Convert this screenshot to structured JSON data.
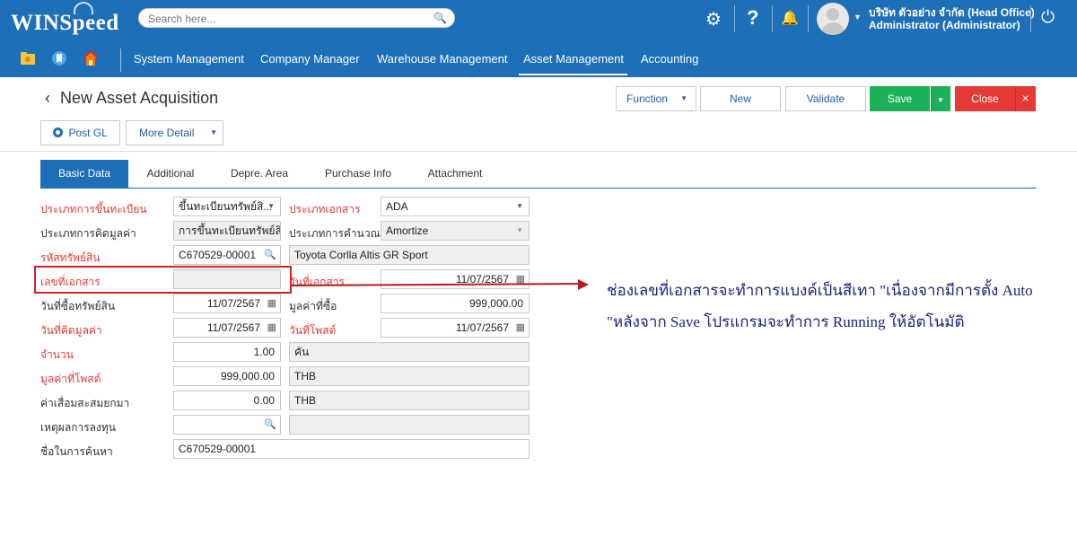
{
  "app": {
    "logo": "WINSpeed",
    "search_placeholder": "Search here...",
    "company": "บริษัท ตัวอย่าง จำกัด (Head Office)",
    "user": "Administrator (Administrator)"
  },
  "icons": {
    "settings": "⚙",
    "help": "?",
    "bell": "🔔",
    "power": "⏻",
    "search": "🔍",
    "calendar": "▦",
    "dropdown": "▼",
    "back": "‹",
    "close": "×"
  },
  "nav": [
    "System Management",
    "Company Manager",
    "Warehouse Management",
    "Asset Management",
    "Accounting"
  ],
  "page": {
    "title": "New Asset Acquisition",
    "buttons": {
      "function": "Function",
      "new": "New",
      "validate": "Validate",
      "save": "Save",
      "close": "Close",
      "post_gl": "Post GL",
      "more_detail": "More Detail"
    }
  },
  "tabs": [
    "Basic Data",
    "Additional",
    "Depre. Area",
    "Purchase Info",
    "Attachment"
  ],
  "form": {
    "reg_type_label": "ประเภทการขึ้นทะเบียน",
    "reg_type_value": "ขึ้นทะเบียนทรัพย์สิ...",
    "doc_type_label": "ประเภทเอกสาร",
    "doc_type_value": "ADA",
    "valuation_type_label": "ประเภทการคิดมูลค่า",
    "valuation_type_value": "การขึ้นทะเบียนทรัพย์สิ",
    "calc_type_label": "ประเภทการคำนวณ",
    "calc_type_value": "Amortize",
    "asset_code_label": "รหัสทรัพย์สิน",
    "asset_code_value": "C670529-00001",
    "asset_name_value": "Toyota Corlla Altis GR Sport",
    "doc_no_label": "เลขที่เอกสาร",
    "doc_no_value": "",
    "doc_date_label": "วันที่เอกสาร",
    "doc_date_value": "11/07/2567",
    "purchase_date_label": "วันที่ซื้อทรัพย์สิน",
    "purchase_date_value": "11/07/2567",
    "purchase_value_label": "มูลค่าที่ซื้อ",
    "purchase_value_value": "999,000.00",
    "valuation_date_label": "วันที่คิดมูลค่า",
    "valuation_date_value": "11/07/2567",
    "post_date_label": "วันที่โพสต์",
    "post_date_value": "11/07/2567",
    "qty_label": "จำนวน",
    "qty_value": "1.00",
    "unit_value": "คัน",
    "post_value_label": "มูลค่าที่โพสต์",
    "post_value_value": "999,000.00",
    "post_value_currency": "THB",
    "accum_depre_label": "ค่าเสื่อมสะสมยกมา",
    "accum_depre_value": "0.00",
    "accum_depre_currency": "THB",
    "invest_reason_label": "เหตุผลการลงทุน",
    "invest_reason_value": "",
    "search_name_label": "ชื่อในการค้นหา",
    "search_name_value": "C670529-00001"
  },
  "annotation": {
    "line1": "ช่องเลขที่เอกสารจะทำการแบงค์เป็นสีเทา \"เนื่องจากมีการตั้ง Auto",
    "line2": "\"หลังจาก Save โปรแกรมจะทำการ Running ให้อัตโนมัติ"
  }
}
